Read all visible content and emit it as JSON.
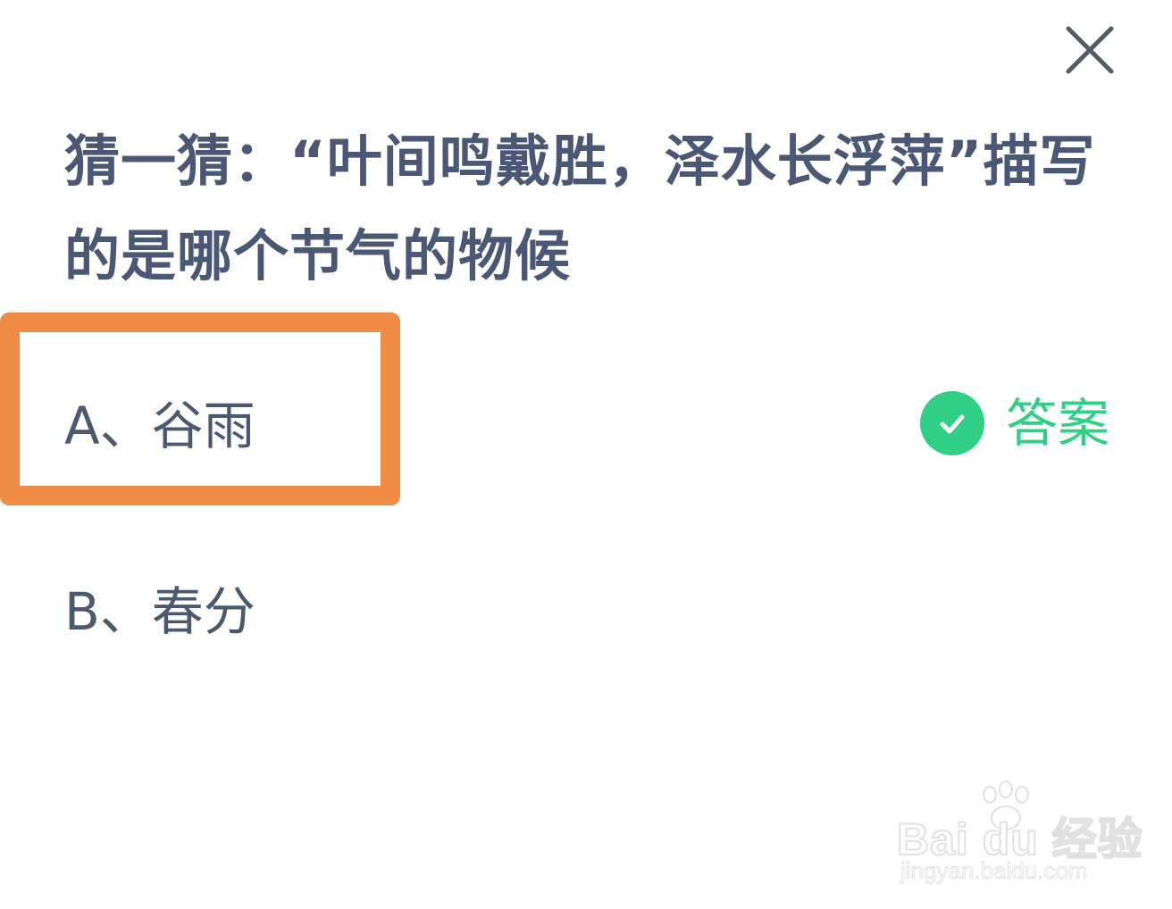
{
  "quiz": {
    "question": "猜一猜：“叶间鸣戴胜，泽水长浮萍”描写的是哪个节气的物候",
    "options": [
      {
        "label": "A、谷雨"
      },
      {
        "label": "B、春分"
      }
    ],
    "answer_label": "答案",
    "close_icon": "close-icon",
    "answer_icon": "check-circle-icon"
  },
  "watermark": {
    "brand": "Bai du 经验",
    "url": "jingyan.baidu.com"
  },
  "colors": {
    "question_text": "#4a5876",
    "option_text": "#4b5970",
    "answer_green": "#2fcf86",
    "highlight_orange": "#f08c45",
    "background": "#ffffff"
  }
}
